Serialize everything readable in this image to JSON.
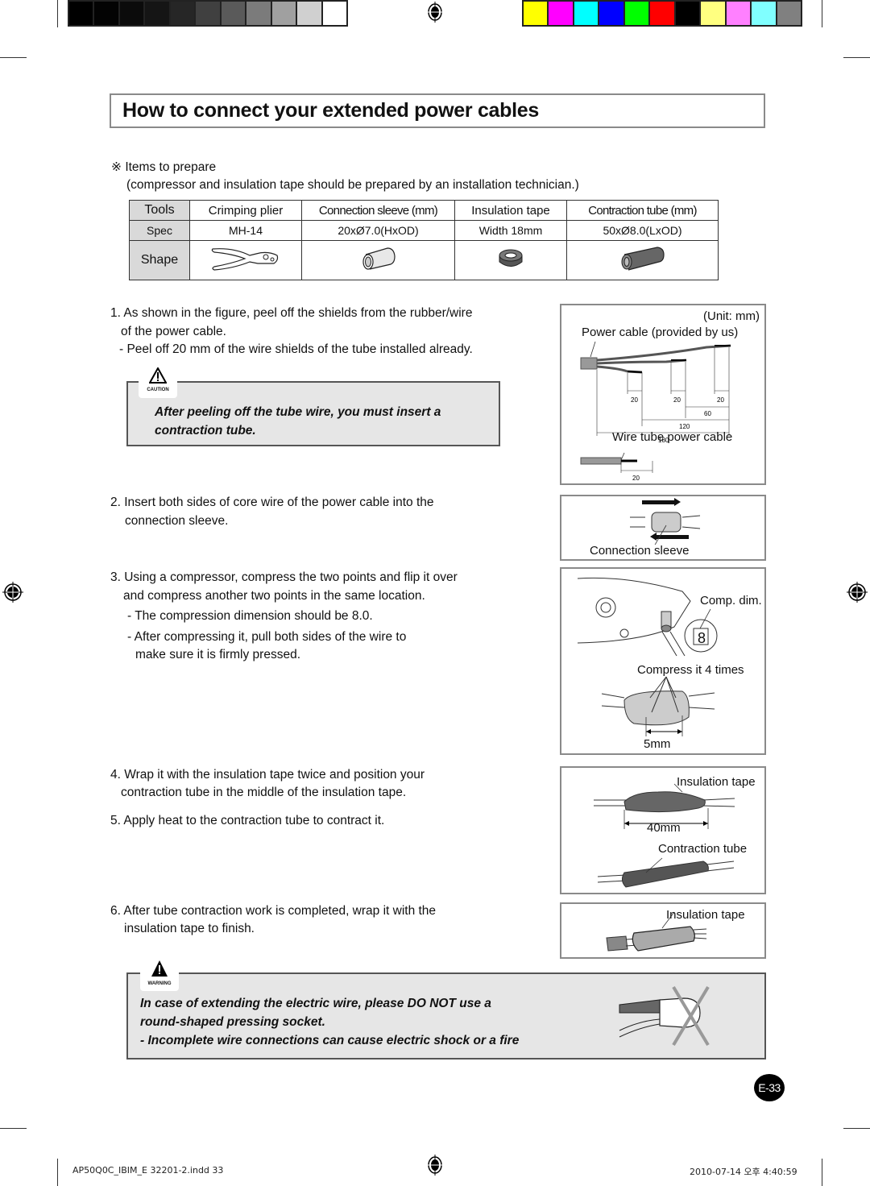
{
  "print_marks": {
    "grayscale_swatches": [
      "#000000",
      "#030303",
      "#0b0b0b",
      "#151515",
      "#262626",
      "#404040",
      "#5a5a5a",
      "#7b7b7b",
      "#a0a0a0",
      "#d0d0d0",
      "#ffffff"
    ],
    "color_swatches": [
      "#ffff00",
      "#ff00ff",
      "#00ffff",
      "#0000ff",
      "#00ff00",
      "#ff0000",
      "#000000",
      "#ffff80",
      "#ff80ff",
      "#80ffff",
      "#808080"
    ]
  },
  "title": "How to connect your extended power cables",
  "prepare": {
    "heading": "Items to prepare",
    "symbol": "※",
    "note": "(compressor and insulation tape should be prepared by an installation technician.)"
  },
  "items_table": {
    "row_headers": [
      "Tools",
      "Spec",
      "Shape"
    ],
    "columns": [
      {
        "tool": "Crimping plier",
        "spec": "MH-14",
        "shape": "crimping-plier"
      },
      {
        "tool": "Connection sleeve (mm)",
        "spec": "20xØ7.0(HxOD)",
        "shape": "connection-sleeve"
      },
      {
        "tool": "Insulation tape",
        "spec": "Width 18mm",
        "shape": "insulation-tape-roll"
      },
      {
        "tool": "Contraction tube (mm)",
        "spec": "50xØ8.0(LxOD)",
        "shape": "contraction-tube"
      }
    ]
  },
  "steps": {
    "s1_line1": "1. As shown in the figure, peel off the shields from the  rubber/wire",
    "s1_line2": "of the power cable.",
    "s1_sub": "- Peel off 20 mm of the wire shields of the tube installed already.",
    "s2_line1": "2. Insert both sides of core wire of the power cable into the",
    "s2_line2": "connection sleeve.",
    "s3_line1": "3. Using a compressor, compress the two points and flip it over",
    "s3_line2": "and compress another two points in the same location.",
    "s3_sub1": "- The compression dimension should be 8.0.",
    "s3_sub2a": "- After compressing it, pull both sides of the wire to",
    "s3_sub2b": "make sure it is firmly pressed.",
    "s4_line1": "4. Wrap it with the insulation tape twice and position your",
    "s4_line2": "contraction tube in the middle of the insulation tape.",
    "s5": "5. Apply heat to the contraction tube to contract it.",
    "s6_line1": "6. After tube contraction work is completed, wrap it with the",
    "s6_line2": "insulation tape to finish."
  },
  "caution": {
    "label": "CAUTION",
    "line1": "After peeling off the tube wire, you must insert a",
    "line2": "contraction tube."
  },
  "warning": {
    "label": "WARNING",
    "line1": "In case of extending the electric wire, please DO NOT use a",
    "line2": "round-shaped pressing socket.",
    "line3": "- Incomplete wire connections can cause electric shock or a fire"
  },
  "figures": {
    "fig1": {
      "unit": "(Unit: mm)",
      "power_cable": "Power cable (provided by us)",
      "dims": [
        "20",
        "20",
        "20",
        "60",
        "120",
        "180"
      ],
      "wire_tube": "Wire tube power cable",
      "wire_tube_dim": "20"
    },
    "fig2": {
      "label": "Connection sleeve"
    },
    "fig3": {
      "comp_dim": "Comp. dim.",
      "comp_value": "8",
      "compress": "Compress it 4 times",
      "spacing": "5mm"
    },
    "fig4": {
      "tape": "Insulation tape",
      "length": "40mm",
      "tube": "Contraction tube"
    },
    "fig5": {
      "tape": "Insulation tape"
    }
  },
  "page_badge": "E-33",
  "footer": {
    "file": "AP50Q0C_IBIM_E 32201-2.indd   33",
    "timestamp": "2010-07-14   오후 4:40:59"
  }
}
